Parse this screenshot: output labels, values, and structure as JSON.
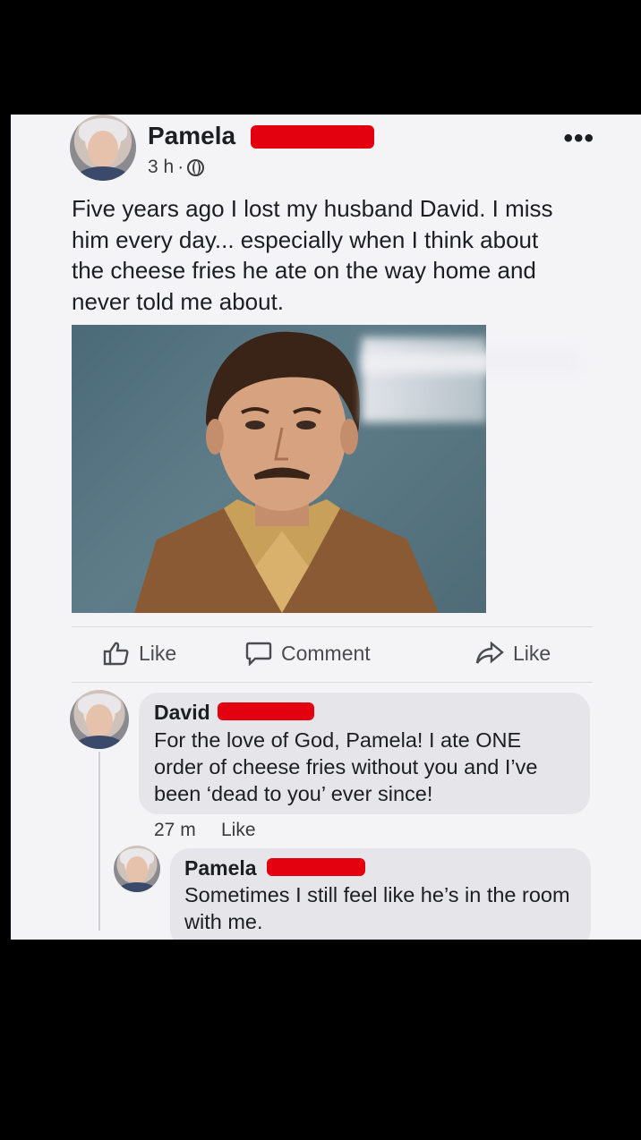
{
  "post": {
    "author": "Pamela",
    "time": "3 h",
    "separator": "·",
    "text": "Five years ago I lost my husband David. I miss him every day... especially when I think about the cheese fries he ate on the way home and never told me about.",
    "more_label": "•••",
    "photo_icon": "portrait-photo"
  },
  "actions": {
    "like": "Like",
    "comment": "Comment",
    "share": "Like"
  },
  "comments": [
    {
      "author": "David",
      "text": "For the love of God, Pamela! I ate ONE order of cheese fries without you and I’ve been ‘dead to you’ ever since!",
      "time": "27 m",
      "like": "Like"
    },
    {
      "author": "Pamela",
      "text": "Sometimes I still feel like he’s in the room with me."
    }
  ],
  "colors": {
    "background": "#000000",
    "card": "#f4f3f6",
    "bubble": "#e6e5ea",
    "redaction": "#e3000f"
  }
}
